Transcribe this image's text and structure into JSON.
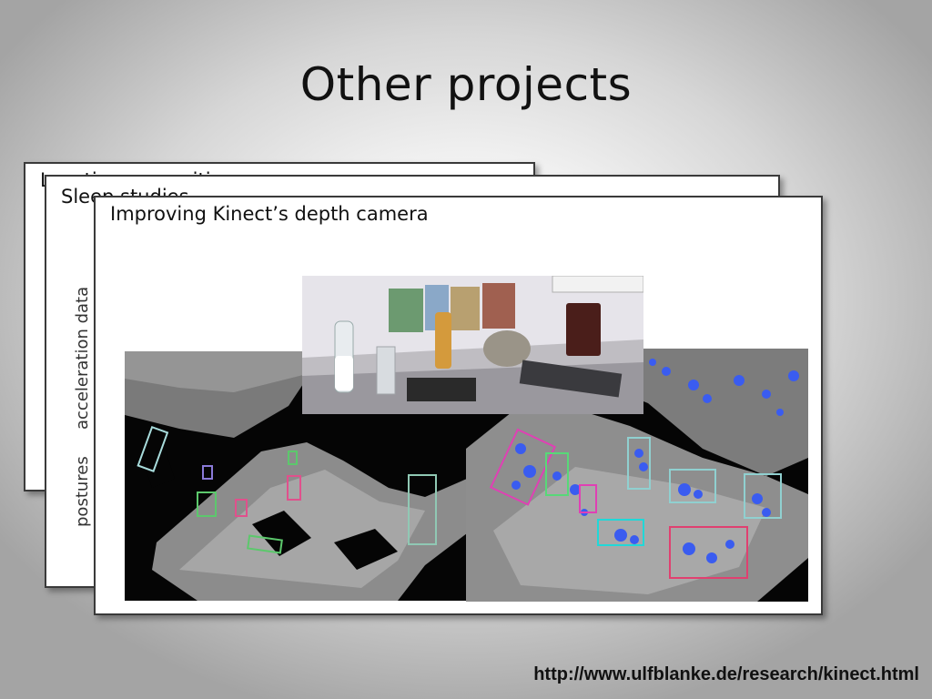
{
  "slide": {
    "title": "Other projects",
    "url": "http://www.ulfblanke.de/research/kinect.html"
  },
  "cards": {
    "back": {
      "title": "Location recognition"
    },
    "middle": {
      "title": "Sleep studies",
      "labels": {
        "acceleration": "acceleration data",
        "postures": "postures"
      }
    },
    "front": {
      "title": "Improving Kinect’s depth camera"
    }
  }
}
